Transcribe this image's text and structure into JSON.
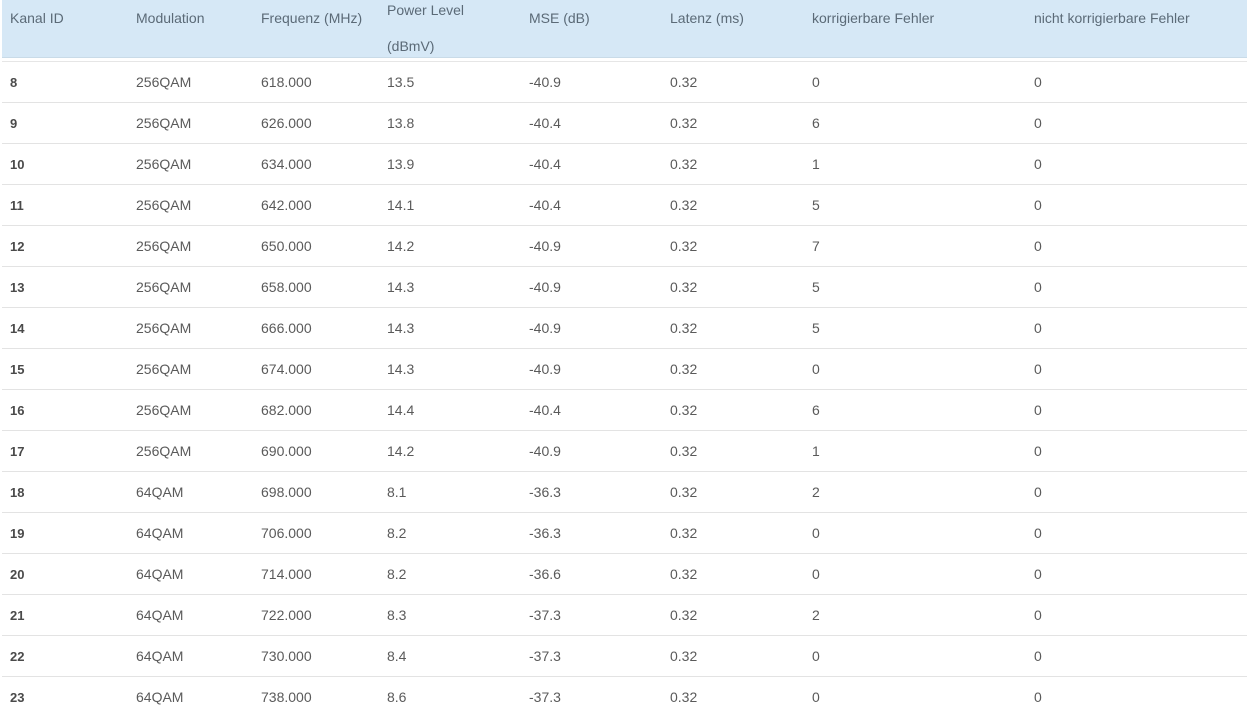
{
  "table": {
    "headers": [
      "Kanal ID",
      "Modulation",
      "Frequenz (MHz)",
      "Power Level (dBmV)",
      "MSE (dB)",
      "Latenz (ms)",
      "korrigierbare Fehler",
      "nicht korrigierbare Fehler"
    ],
    "header_power_line1": "Power Level",
    "header_power_line2": "(dBmV)",
    "rows": [
      [
        "8",
        "256QAM",
        "618.000",
        "13.5",
        "-40.9",
        "0.32",
        "0",
        "0"
      ],
      [
        "9",
        "256QAM",
        "626.000",
        "13.8",
        "-40.4",
        "0.32",
        "6",
        "0"
      ],
      [
        "10",
        "256QAM",
        "634.000",
        "13.9",
        "-40.4",
        "0.32",
        "1",
        "0"
      ],
      [
        "11",
        "256QAM",
        "642.000",
        "14.1",
        "-40.4",
        "0.32",
        "5",
        "0"
      ],
      [
        "12",
        "256QAM",
        "650.000",
        "14.2",
        "-40.9",
        "0.32",
        "7",
        "0"
      ],
      [
        "13",
        "256QAM",
        "658.000",
        "14.3",
        "-40.9",
        "0.32",
        "5",
        "0"
      ],
      [
        "14",
        "256QAM",
        "666.000",
        "14.3",
        "-40.9",
        "0.32",
        "5",
        "0"
      ],
      [
        "15",
        "256QAM",
        "674.000",
        "14.3",
        "-40.9",
        "0.32",
        "0",
        "0"
      ],
      [
        "16",
        "256QAM",
        "682.000",
        "14.4",
        "-40.4",
        "0.32",
        "6",
        "0"
      ],
      [
        "17",
        "256QAM",
        "690.000",
        "14.2",
        "-40.9",
        "0.32",
        "1",
        "0"
      ],
      [
        "18",
        "64QAM",
        "698.000",
        "8.1",
        "-36.3",
        "0.32",
        "2",
        "0"
      ],
      [
        "19",
        "64QAM",
        "706.000",
        "8.2",
        "-36.3",
        "0.32",
        "0",
        "0"
      ],
      [
        "20",
        "64QAM",
        "714.000",
        "8.2",
        "-36.6",
        "0.32",
        "0",
        "0"
      ],
      [
        "21",
        "64QAM",
        "722.000",
        "8.3",
        "-37.3",
        "0.32",
        "2",
        "0"
      ],
      [
        "22",
        "64QAM",
        "730.000",
        "8.4",
        "-37.3",
        "0.32",
        "0",
        "0"
      ],
      [
        "23",
        "64QAM",
        "738.000",
        "8.6",
        "-37.3",
        "0.32",
        "0",
        "0"
      ]
    ]
  },
  "colors": {
    "header_bg": "#d6e8f6",
    "header_text": "#5b6a77",
    "row_border": "#e3e3e3",
    "cell_text": "#5a5a5a"
  }
}
